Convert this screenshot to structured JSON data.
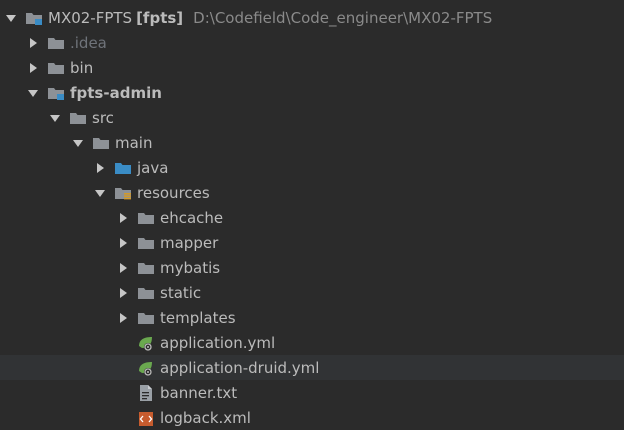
{
  "project": {
    "name": "MX02-FPTS",
    "module_tag": "[fpts]",
    "path": "D:\\Codefield\\Code_engineer\\MX02-FPTS"
  },
  "tree": {
    "idea": ".idea",
    "bin": "bin",
    "fpts_admin": "fpts-admin",
    "src": "src",
    "main": "main",
    "java": "java",
    "resources": "resources",
    "ehcache": "ehcache",
    "mapper": "mapper",
    "mybatis": "mybatis",
    "static": "static",
    "templates": "templates",
    "application_yml": "application.yml",
    "application_druid_yml": "application-druid.yml",
    "banner_txt": "banner.txt",
    "logback_xml": "logback.xml"
  },
  "icons": {
    "arrow": "chevron-icon",
    "folder": "folder-icon",
    "module": "module-folder-icon",
    "source_root": "source-root-folder-icon",
    "resources_root": "resources-root-folder-icon",
    "yml": "spring-config-icon",
    "txt": "text-file-icon",
    "xml": "xml-file-icon"
  },
  "colors": {
    "background": "#2b2b2b",
    "text": "#bbbbbb",
    "dim_text": "#6f737a",
    "folder": "#8d9196",
    "source_root": "#3a8cc5",
    "spring_green": "#6aa84f",
    "xml_orange": "#c75c2e"
  }
}
